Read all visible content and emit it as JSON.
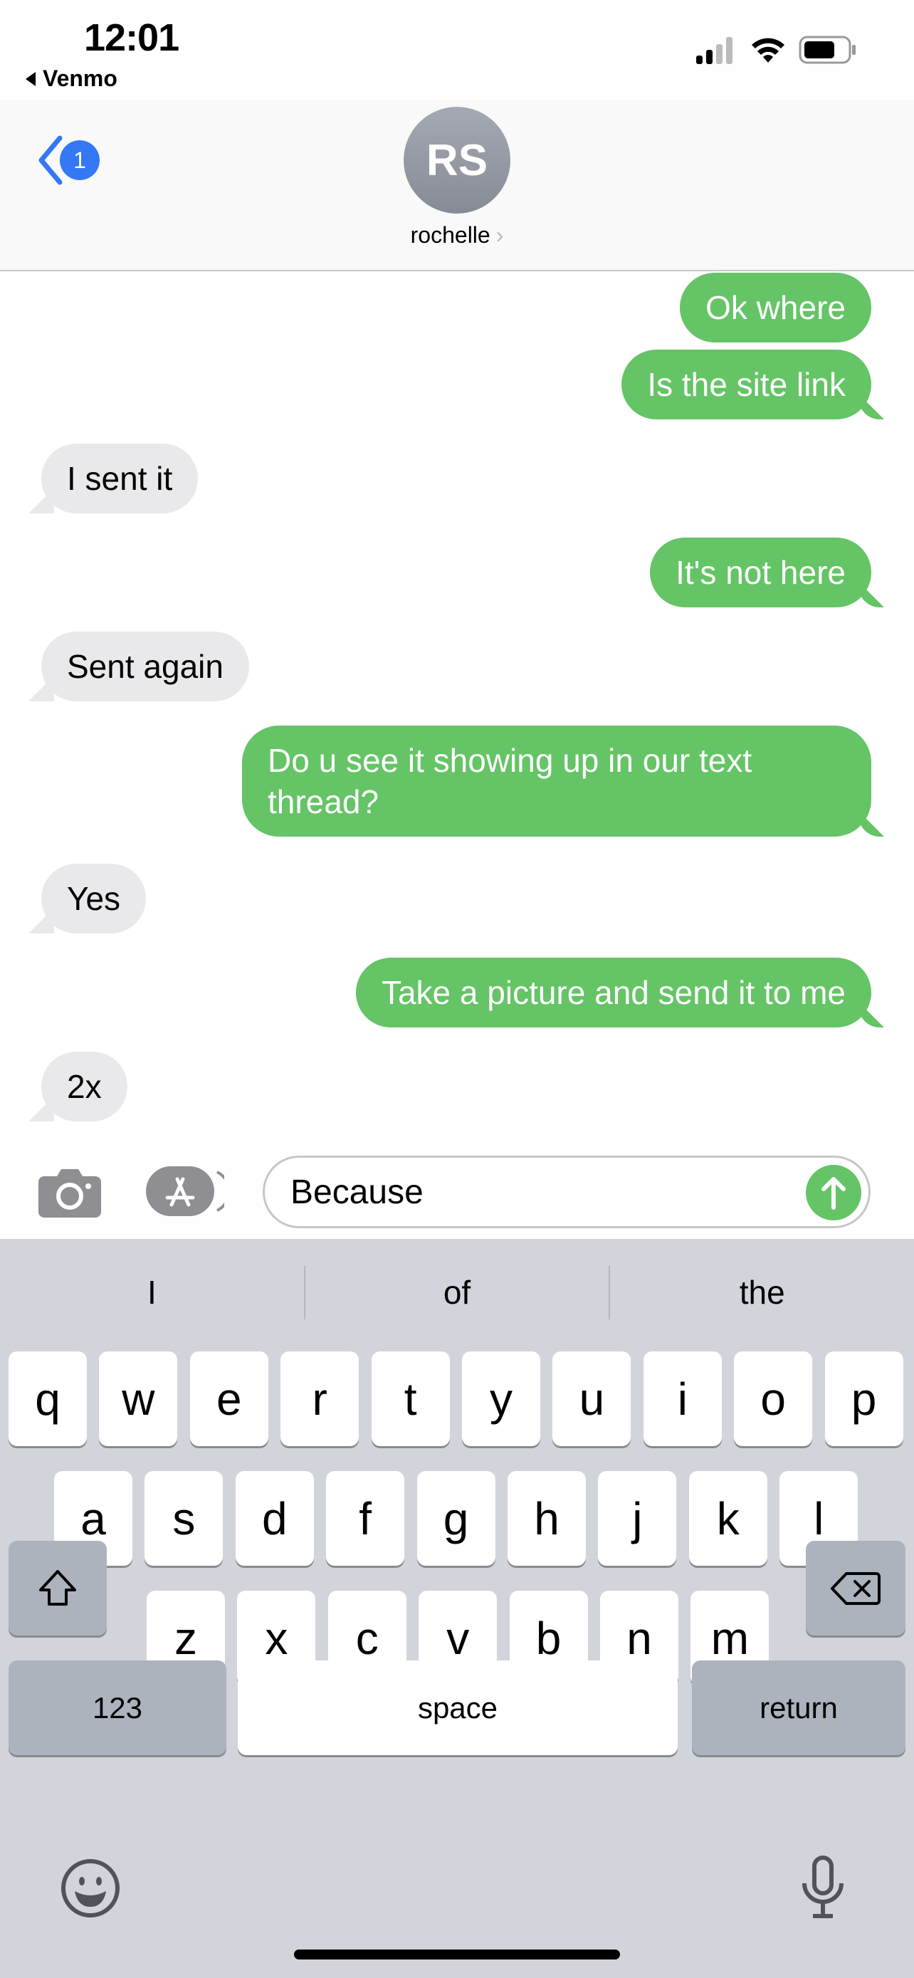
{
  "status_bar": {
    "time": "12:01",
    "back_app": "Venmo",
    "battery_level": 0.7
  },
  "header": {
    "unread_badge": "1",
    "avatar_initials": "RS",
    "contact_name": "rochelle"
  },
  "messages": [
    {
      "dir": "out",
      "text": "Ok where",
      "tail": false
    },
    {
      "dir": "out",
      "text": "Is the site link",
      "tail": true
    },
    {
      "dir": "in",
      "text": "I sent it",
      "tail": true
    },
    {
      "dir": "out",
      "text": "It's not here",
      "tail": true
    },
    {
      "dir": "in",
      "text": "Sent again",
      "tail": true
    },
    {
      "dir": "out",
      "text": "Do u see it showing up in our text thread?",
      "tail": true
    },
    {
      "dir": "in",
      "text": "Yes",
      "tail": true
    },
    {
      "dir": "out",
      "text": "Take a picture and send it to me",
      "tail": true
    },
    {
      "dir": "in",
      "text": "2x",
      "tail": true
    }
  ],
  "composer": {
    "value": "Because"
  },
  "keyboard": {
    "predictions": [
      "I",
      "of",
      "the"
    ],
    "row1": [
      "q",
      "w",
      "e",
      "r",
      "t",
      "y",
      "u",
      "i",
      "o",
      "p"
    ],
    "row2": [
      "a",
      "s",
      "d",
      "f",
      "g",
      "h",
      "j",
      "k",
      "l"
    ],
    "row3": [
      "z",
      "x",
      "c",
      "v",
      "b",
      "n",
      "m"
    ],
    "numbers_label": "123",
    "space_label": "space",
    "return_label": "return"
  },
  "colors": {
    "sent_bubble": "#65c466",
    "received_bubble": "#e9e9eb",
    "accent": "#3478f6"
  }
}
